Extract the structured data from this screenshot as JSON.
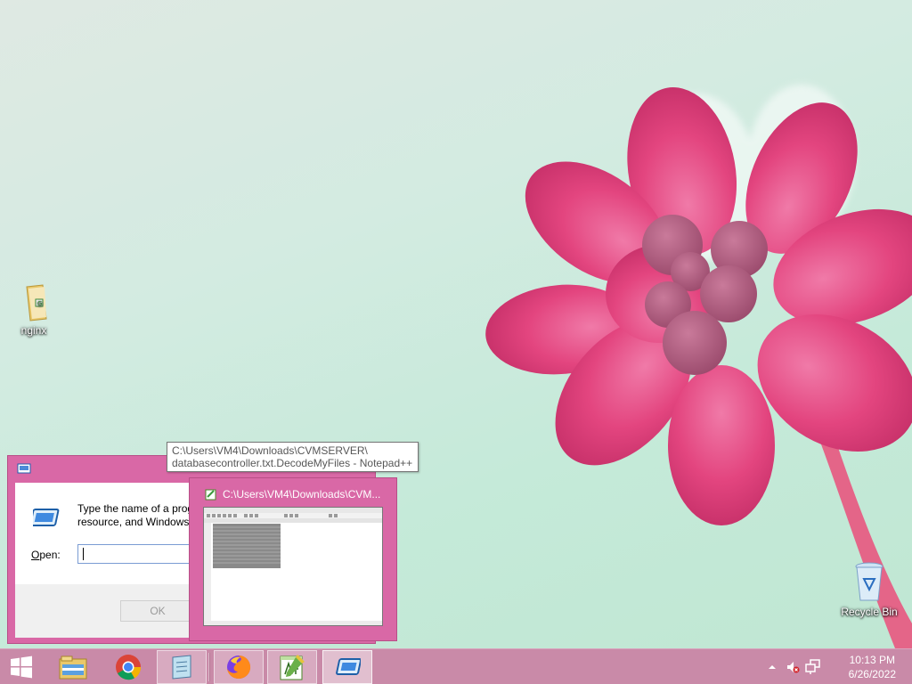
{
  "desktop": {
    "icons": [
      {
        "label": "nginx",
        "icon": "folder-icon"
      },
      {
        "label": "Recycle Bin",
        "icon": "recycle-bin-icon"
      }
    ]
  },
  "run_dialog": {
    "description": "Type the name of a progr\nresource, and Windows w",
    "open_label_key": "O",
    "open_label_rest": "pen:",
    "input_value": "",
    "ok_label": "OK"
  },
  "tooltip": {
    "line1": "C:\\Users\\VM4\\Downloads\\CVMSERVER\\",
    "line2": "databasecontroller.txt.DecodeMyFiles - Notepad++"
  },
  "thumbnail": {
    "title": "C:\\Users\\VM4\\Downloads\\CVM..."
  },
  "taskbar": {
    "buttons": [
      {
        "name": "start",
        "icon": "windows-logo-icon"
      },
      {
        "name": "file-explorer",
        "icon": "file-explorer-icon"
      },
      {
        "name": "chrome",
        "icon": "chrome-icon"
      },
      {
        "name": "notepad-app",
        "icon": "notepad-icon"
      },
      {
        "name": "firefox",
        "icon": "firefox-icon"
      },
      {
        "name": "notepad-plus-plus",
        "icon": "notepad-plus-plus-icon"
      },
      {
        "name": "run",
        "icon": "run-icon"
      }
    ],
    "tray": {
      "time": "10:13 PM",
      "date": "6/26/2022"
    }
  },
  "colors": {
    "window_frame": "#d968a6",
    "taskbar": "#c98aa8",
    "flower": "#e0457f"
  }
}
